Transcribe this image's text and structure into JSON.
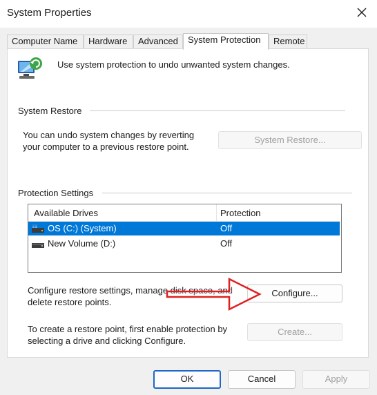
{
  "window": {
    "title": "System Properties"
  },
  "tabs": [
    {
      "label": "Computer Name"
    },
    {
      "label": "Hardware"
    },
    {
      "label": "Advanced"
    },
    {
      "label": "System Protection",
      "active": true
    },
    {
      "label": "Remote"
    }
  ],
  "header": {
    "description": "Use system protection to undo unwanted system changes."
  },
  "system_restore": {
    "group_label": "System Restore",
    "text_line1": "You can undo system changes by reverting",
    "text_line2": "your computer to a previous restore point.",
    "button_label": "System Restore..."
  },
  "protection_settings": {
    "group_label": "Protection Settings",
    "columns": [
      "Available Drives",
      "Protection"
    ],
    "drives": [
      {
        "name": "OS (C:) (System)",
        "protection": "Off",
        "selected": true
      },
      {
        "name": "New Volume (D:)",
        "protection": "Off",
        "selected": false
      }
    ],
    "configure_line1": "Configure restore settings, manage disk space, and",
    "configure_line2": "delete restore points.",
    "configure_button": "Configure...",
    "create_line1": "To create a restore point, first enable protection by",
    "create_line2": "selecting a drive and clicking Configure.",
    "create_button": "Create..."
  },
  "footer": {
    "ok_label": "OK",
    "cancel_label": "Cancel",
    "apply_label": "Apply"
  },
  "colors": {
    "selection": "#0078d7",
    "annotation_arrow": "#e02020",
    "default_button_border": "#1e66c7"
  }
}
